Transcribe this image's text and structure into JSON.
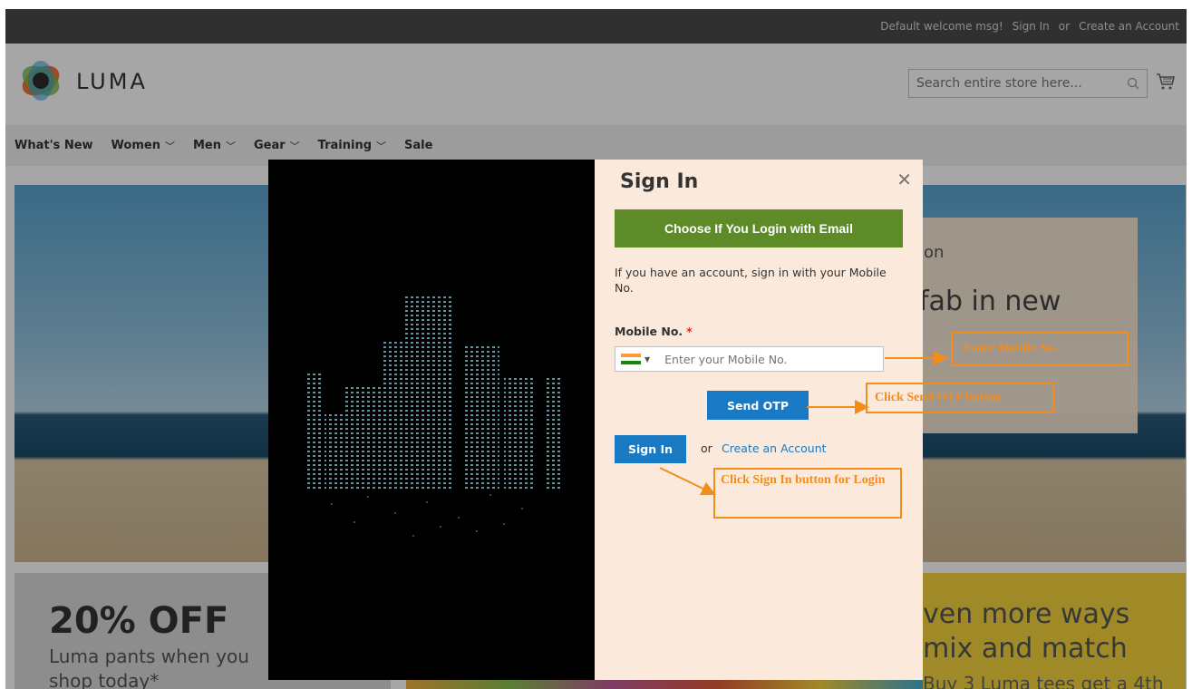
{
  "topbar": {
    "welcome": "Default welcome msg!",
    "sign_in": "Sign In",
    "or": "or",
    "create_account": "Create an Account"
  },
  "header": {
    "logo_text": "LUMA",
    "search_placeholder": "Search entire store here..."
  },
  "nav": {
    "items": [
      {
        "label": "What's New",
        "dropdown": false
      },
      {
        "label": "Women",
        "dropdown": true
      },
      {
        "label": "Men",
        "dropdown": true
      },
      {
        "label": "Gear",
        "dropdown": true
      },
      {
        "label": "Training",
        "dropdown": true
      },
      {
        "label": "Sale",
        "dropdown": false
      }
    ]
  },
  "background": {
    "hero_text_1": "ion",
    "hero_text_2": "fab in new",
    "promo_left_big": "20% OFF",
    "promo_left_line1": "Luma pants when you",
    "promo_left_line2": "shop today*",
    "promo_right_line1": "ven more ways",
    "promo_right_line2": "mix and match",
    "promo_right_line3": "Buy 3 Luma tees get a 4th"
  },
  "modal": {
    "title": "Sign In",
    "email_button": "Choose If You Login with Email",
    "intro": "If you have an account, sign in with your Mobile No.",
    "mobile_label": "Mobile No.",
    "required_mark": "*",
    "mobile_placeholder": "Enter your Mobile No.",
    "mobile_value": "",
    "send_otp": "Send OTP",
    "sign_in_button": "Sign In",
    "or": "or",
    "create_account": "Create an Account",
    "close_icon": "close-icon"
  },
  "annotations": {
    "enter_mobile": "Enter Mobile No.",
    "click_send_otp": "Click Send OTP button",
    "click_sign_in": "Click Sign In button for Login"
  },
  "colors": {
    "email_button": "#5d8b28",
    "primary_button": "#1979c3",
    "annotation": "#f28c1b",
    "form_bg": "#fbeadb"
  }
}
